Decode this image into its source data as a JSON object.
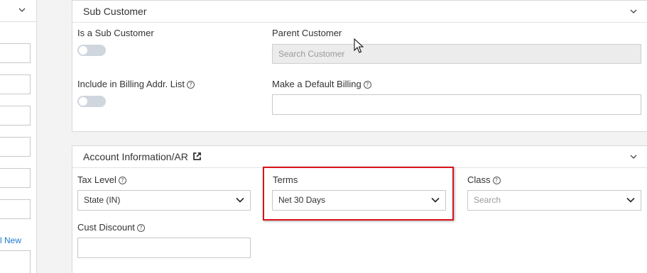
{
  "left_panel": {
    "link_text": "l New"
  },
  "sub_customer": {
    "title": "Sub Customer",
    "is_sub_label": "Is a Sub Customer",
    "parent_label": "Parent Customer",
    "parent_placeholder": "Search Customer",
    "include_billing_label": "Include in Billing Addr. List",
    "default_billing_label": "Make a Default Billing",
    "is_sub_on": false,
    "include_billing_on": false
  },
  "account_info": {
    "title": "Account Information/AR",
    "tax_level_label": "Tax Level",
    "tax_level_value": "State (IN)",
    "terms_label": "Terms",
    "terms_value": "Net 30 Days",
    "class_label": "Class",
    "class_placeholder": "Search",
    "cust_discount_label": "Cust Discount"
  },
  "colors": {
    "highlight": "#d9141c",
    "link": "#1f7bd0"
  },
  "icons": [
    "chevron-down-icon",
    "help-icon",
    "external-link-icon",
    "mouse-cursor-icon"
  ]
}
